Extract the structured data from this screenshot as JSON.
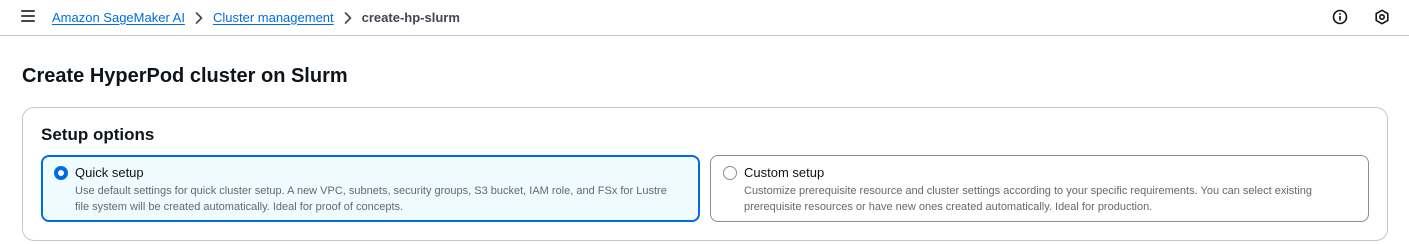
{
  "breadcrumb": {
    "items": [
      {
        "label": "Amazon SageMaker AI"
      },
      {
        "label": "Cluster management"
      },
      {
        "label": "create-hp-slurm"
      }
    ]
  },
  "header": {
    "icons": [
      "menu-icon",
      "info-icon",
      "settings-icon"
    ]
  },
  "page": {
    "title": "Create HyperPod cluster on Slurm"
  },
  "setup_options": {
    "title": "Setup options",
    "options": [
      {
        "label": "Quick setup",
        "description": "Use default settings for quick cluster setup. A new VPC, subnets, security groups, S3 bucket, IAM role, and FSx for Lustre file system will be created automatically. Ideal for proof of concepts.",
        "selected": true
      },
      {
        "label": "Custom setup",
        "description": "Customize prerequisite resource and cluster settings according to your specific requirements. You can select existing prerequisite resources or have new ones created automatically. Ideal for production.",
        "selected": false
      }
    ]
  },
  "colors": {
    "accent": "#006ce0",
    "selected_bg": "#f0fbff",
    "border": "#c6c6cd",
    "text": "#0f141a",
    "muted_text": "#656871"
  }
}
